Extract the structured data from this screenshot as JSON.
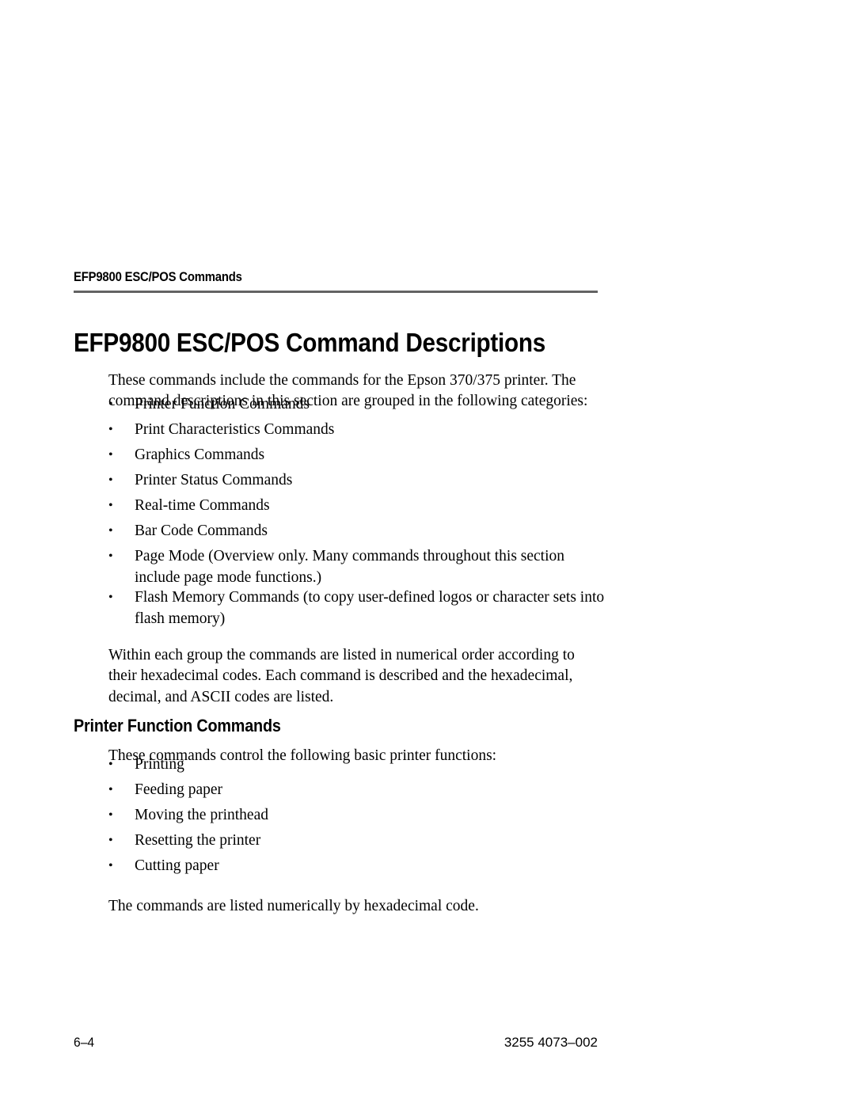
{
  "running_head": "EFP9800 ESC/POS Commands",
  "title": "EFP9800 ESC/POS Command Descriptions",
  "intro_paragraph": "These commands include the commands for the Epson 370/375 printer. The command descriptions in this section are grouped in the following categories:",
  "category_bullets": [
    "Printer Function Commands",
    "Print Characteristics Commands",
    "Graphics Commands",
    "Printer Status Commands",
    "Real-time Commands",
    "Bar Code Commands",
    "Page Mode (Overview only. Many commands throughout this section include page mode functions.)",
    "Flash Memory Commands (to copy user-defined logos or character sets into flash memory)"
  ],
  "ordering_paragraph": "Within each group the commands are listed in numerical order according to their hexadecimal codes. Each command is described and the hexadecimal, decimal, and ASCII codes are listed.",
  "section": {
    "heading": "Printer Function Commands",
    "intro": "These commands control the following basic printer functions:",
    "bullets": [
      "Printing",
      "Feeding paper",
      "Moving the printhead",
      "Resetting the printer",
      "Cutting paper"
    ],
    "closing": "The commands are listed numerically by hexadecimal code."
  },
  "bullet_glyph": "•",
  "footer": {
    "page_number": "6–4",
    "document_number": "3255 4073–002"
  },
  "colors": {
    "text": "#000000",
    "rule": "#636363",
    "background": "#ffffff"
  }
}
